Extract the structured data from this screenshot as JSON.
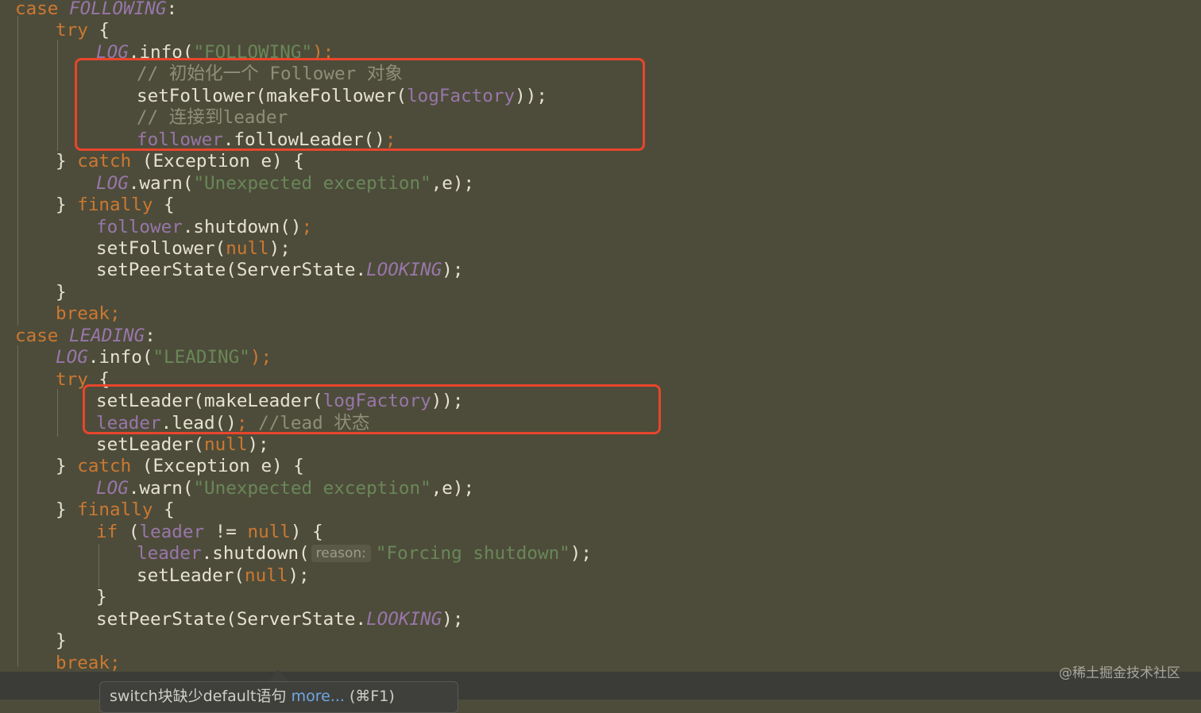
{
  "code": {
    "lines": [
      [
        {
          "t": "case ",
          "c": "kw"
        },
        {
          "t": "FOLLOWING",
          "c": "pu it"
        },
        {
          "t": ":",
          "c": "pl"
        }
      ],
      [
        {
          "t": "try",
          "c": "kw"
        },
        {
          "t": " {",
          "c": "pl"
        }
      ],
      [
        {
          "t": "LOG",
          "c": "pu it"
        },
        {
          "t": ".info(",
          "c": "pl"
        },
        {
          "t": "\"FOLLOWING\"",
          "c": "st"
        },
        {
          "t": ");",
          "c": "kw"
        }
      ],
      [
        {
          "t": "// 初始化一个 Follower 对象",
          "c": "cm"
        }
      ],
      [
        {
          "t": "setFollower(makeFollower(",
          "c": "fn"
        },
        {
          "t": "logFactory",
          "c": "pu"
        },
        {
          "t": "));",
          "c": "pl"
        }
      ],
      [
        {
          "t": "// 连接到leader",
          "c": "cm"
        }
      ],
      [
        {
          "t": "follower",
          "c": "pu"
        },
        {
          "t": ".followLeader()",
          "c": "fn"
        },
        {
          "t": ";",
          "c": "kw"
        }
      ],
      [
        {
          "t": "} ",
          "c": "pl"
        },
        {
          "t": "catch",
          "c": "kw"
        },
        {
          "t": " (Exception e) {",
          "c": "pl"
        }
      ],
      [
        {
          "t": "LOG",
          "c": "pu it"
        },
        {
          "t": ".warn(",
          "c": "pl"
        },
        {
          "t": "\"Unexpected exception\"",
          "c": "st"
        },
        {
          "t": ",e);",
          "c": "pl"
        }
      ],
      [
        {
          "t": "} ",
          "c": "pl"
        },
        {
          "t": "finally",
          "c": "kw"
        },
        {
          "t": " {",
          "c": "pl"
        }
      ],
      [
        {
          "t": "follower",
          "c": "pu"
        },
        {
          "t": ".shutdown()",
          "c": "fn"
        },
        {
          "t": ";",
          "c": "kw"
        }
      ],
      [
        {
          "t": "setFollower(",
          "c": "fn"
        },
        {
          "t": "null",
          "c": "kw"
        },
        {
          "t": ");",
          "c": "pl"
        }
      ],
      [
        {
          "t": "setPeerState(ServerState.",
          "c": "fn"
        },
        {
          "t": "LOOKING",
          "c": "pu it"
        },
        {
          "t": ");",
          "c": "pl"
        }
      ],
      [
        {
          "t": "}",
          "c": "pl"
        }
      ],
      [
        {
          "t": "break;",
          "c": "kw"
        }
      ],
      [
        {
          "t": "case ",
          "c": "kw"
        },
        {
          "t": "LEADING",
          "c": "pu it"
        },
        {
          "t": ":",
          "c": "pl"
        }
      ],
      [
        {
          "t": "LOG",
          "c": "pu it"
        },
        {
          "t": ".info(",
          "c": "pl"
        },
        {
          "t": "\"LEADING\"",
          "c": "st"
        },
        {
          "t": ");",
          "c": "kw"
        }
      ],
      [
        {
          "t": "try",
          "c": "kw"
        },
        {
          "t": " {",
          "c": "pl"
        }
      ],
      [
        {
          "t": "setLeader(makeLeader(",
          "c": "fn"
        },
        {
          "t": "logFactory",
          "c": "pu"
        },
        {
          "t": "));",
          "c": "pl"
        }
      ],
      [
        {
          "t": "leader",
          "c": "pu"
        },
        {
          "t": ".lead()",
          "c": "fn"
        },
        {
          "t": "; ",
          "c": "kw"
        },
        {
          "t": "//lead 状态",
          "c": "cm"
        }
      ],
      [
        {
          "t": "setLeader(",
          "c": "fn"
        },
        {
          "t": "null",
          "c": "kw"
        },
        {
          "t": ");",
          "c": "pl"
        }
      ],
      [
        {
          "t": "} ",
          "c": "pl"
        },
        {
          "t": "catch",
          "c": "kw"
        },
        {
          "t": " (Exception e) {",
          "c": "pl"
        }
      ],
      [
        {
          "t": "LOG",
          "c": "pu it"
        },
        {
          "t": ".warn(",
          "c": "pl"
        },
        {
          "t": "\"Unexpected exception\"",
          "c": "st"
        },
        {
          "t": ",e);",
          "c": "pl"
        }
      ],
      [
        {
          "t": "} ",
          "c": "pl"
        },
        {
          "t": "finally",
          "c": "kw"
        },
        {
          "t": " {",
          "c": "pl"
        }
      ],
      [
        {
          "t": "if",
          "c": "kw"
        },
        {
          "t": " (",
          "c": "pl"
        },
        {
          "t": "leader",
          "c": "pu"
        },
        {
          "t": " != ",
          "c": "pl"
        },
        {
          "t": "null",
          "c": "kw"
        },
        {
          "t": ") {",
          "c": "pl"
        }
      ],
      [
        {
          "t": "leader",
          "c": "pu"
        },
        {
          "t": ".shutdown(",
          "c": "fn"
        },
        {
          "hint": "reason:"
        },
        {
          "t": "\"Forcing shutdown\"",
          "c": "st"
        },
        {
          "t": ");",
          "c": "pl"
        }
      ],
      [
        {
          "t": "setLeader(",
          "c": "fn"
        },
        {
          "t": "null",
          "c": "kw"
        },
        {
          "t": ");",
          "c": "pl"
        }
      ],
      [
        {
          "t": "}",
          "c": "pl"
        }
      ],
      [
        {
          "t": "setPeerState(ServerState.",
          "c": "fn"
        },
        {
          "t": "LOOKING",
          "c": "pu it"
        },
        {
          "t": ");",
          "c": "pl"
        }
      ],
      [
        {
          "t": "}",
          "c": "pl"
        }
      ],
      [
        {
          "t": "break;",
          "c": "kw"
        }
      ],
      [
        {
          "t": "}",
          "c": "pl"
        }
      ]
    ]
  },
  "tooltip": {
    "text": "switch块缺少default语句 ",
    "more_link": "more...",
    "shortcut": " (⌘F1)"
  },
  "watermark": "@稀土掘金技术社区"
}
